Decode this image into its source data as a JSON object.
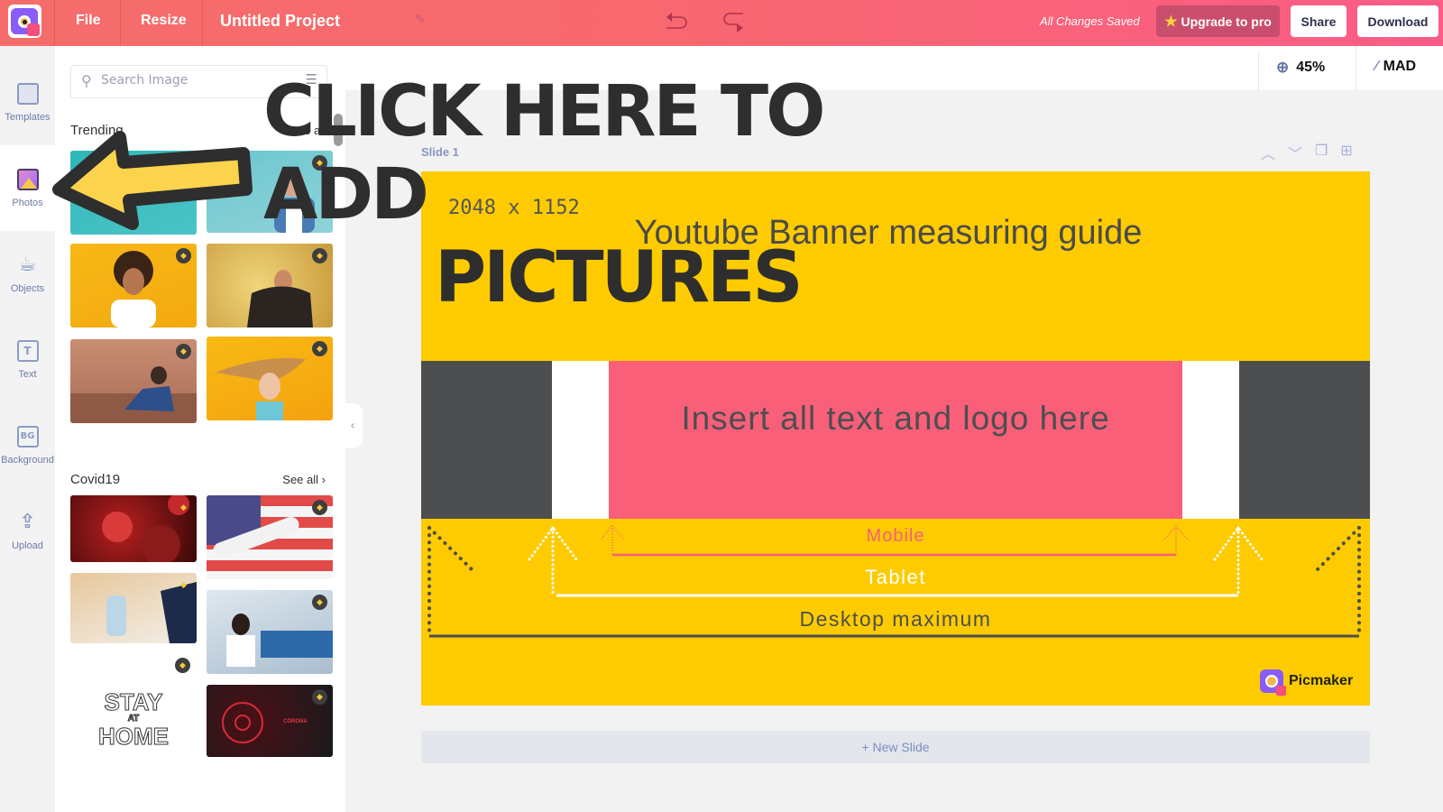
{
  "topbar": {
    "logo_icon": "picmaker-logo-icon",
    "file_label": "File",
    "resize_label": "Resize",
    "project_title": "Untitled Project",
    "edit_icon": "pencil-icon",
    "undo_icon": "undo-icon",
    "redo_icon": "redo-icon",
    "save_status": "All Changes Saved",
    "upgrade_label": "Upgrade to pro",
    "upgrade_icon": "star-icon",
    "share_label": "Share",
    "download_label": "Download"
  },
  "subbar": {
    "zoom_icon": "zoom-in-icon",
    "zoom_value": "45%",
    "magic_icon": "magic-wand-icon",
    "magic_label": "MAD"
  },
  "rail": {
    "items": [
      {
        "label": "Templates",
        "icon": "templates-icon",
        "active": false
      },
      {
        "label": "Photos",
        "icon": "photos-icon",
        "active": true
      },
      {
        "label": "Objects",
        "icon": "cup-icon",
        "active": false
      },
      {
        "label": "Text",
        "icon": "text-icon",
        "active": false,
        "glyph": "T"
      },
      {
        "label": "Background",
        "icon": "background-icon",
        "active": false,
        "glyph": "BG"
      },
      {
        "label": "Upload",
        "icon": "upload-icon",
        "active": false
      }
    ]
  },
  "panel": {
    "search_placeholder": "Search Image",
    "search_icon": "search-icon",
    "filter_icon": "filter-sliders-icon",
    "sections": [
      {
        "title": "Trending",
        "see_all": "See all",
        "images": [
          {
            "desc": "Person on teal background",
            "premium": false
          },
          {
            "desc": "Surprised man lifting glasses on blue background",
            "premium": true
          },
          {
            "desc": "Excited woman with curly hair on yellow background",
            "premium": true
          },
          {
            "desc": "Shocked man holding head on beige background",
            "premium": true
          },
          {
            "desc": "Sad boy sitting against brick wall",
            "premium": true
          },
          {
            "desc": "Woman with flying hair on yellow background",
            "premium": true
          }
        ]
      },
      {
        "title": "Covid19",
        "see_all": "See all",
        "images": [
          {
            "desc": "Coronavirus particles on red background",
            "premium": true
          },
          {
            "desc": "Coronavirus test tube on American flag",
            "premium": true
          },
          {
            "desc": "Hands using sanitizer dispenser",
            "premium": true
          },
          {
            "desc": "Woman wearing mask in airport",
            "premium": true
          },
          {
            "desc": "Stay at home lettering",
            "premium": true
          },
          {
            "desc": "Red coronavirus graphic on dark background",
            "premium": true
          }
        ]
      }
    ],
    "collapse_icon": "chevron-left-icon"
  },
  "canvas": {
    "slide_label": "Slide 1",
    "slide_tools": [
      "chevron-up-icon",
      "chevron-down-icon",
      "duplicate-icon",
      "add-slide-icon"
    ],
    "dimensions": "2048 x 1152",
    "banner_title": "Youtube Banner measuring guide",
    "safe_area_text": "Insert all text and logo here",
    "label_mobile": "Mobile",
    "label_tablet": "Tablet",
    "label_desktop": "Desktop maximum",
    "brand": "Picmaker",
    "new_slide": "+ New Slide",
    "colors": {
      "banner_bg": "#fecb00",
      "safe_area": "#f95f79",
      "dark_band": "#4d4e50",
      "white_band": "#ffffff"
    }
  },
  "overlay": {
    "line1": "CLICK HERE TO ADD",
    "line2": "PICTURES",
    "arrow_icon": "arrow-left-icon",
    "arrow_color": "#fcd34d"
  }
}
